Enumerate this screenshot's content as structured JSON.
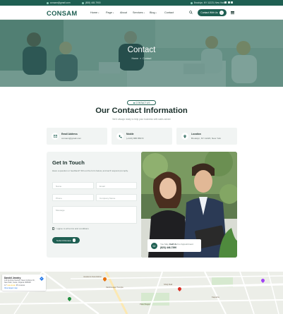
{
  "topbar": {
    "email": "consam@gmail.com",
    "phone": "(808) 445-7900",
    "address": "Brooklyn, NY 11223, New York"
  },
  "nav": {
    "logo": "CONSAM",
    "items": [
      "Home",
      "Page",
      "About",
      "Services",
      "Blog",
      "Contact"
    ],
    "cta": "Contact With Us"
  },
  "hero": {
    "title": "Contact",
    "breadcrumb_home": "Home",
    "breadcrumb_sep": "»",
    "breadcrumb_current": "Contact"
  },
  "info_section": {
    "pill": "CONTACT US",
    "title": "Our Contact Information",
    "subtitle": "We'd always ready to help your business with sales advice",
    "cards": [
      {
        "label": "Email Address",
        "value": "consam@gmail.com",
        "icon": "mail-icon"
      },
      {
        "label": "Mobile",
        "value": "(+123) 888 85672",
        "icon": "phone-icon"
      },
      {
        "label": "Location",
        "value": "Brooklyn, NY 11223, New York",
        "icon": "location-icon"
      }
    ]
  },
  "form": {
    "title": "Get In Touch",
    "description": "Have a question or feedback? Fill out the form below, and we'll respond promptly.",
    "name_placeholder": "Name",
    "email_placeholder": "Email",
    "phone_placeholder": "Phone",
    "company_placeholder": "Company Name",
    "message_placeholder": "Message",
    "agree_label": "I agree to all terms and conditions",
    "submit_label": "Submit Review"
  },
  "call_box": {
    "prefix": "You May",
    "emphasis": "Call Us",
    "suffix": "For Appointment",
    "number": "(823) 446-7390"
  },
  "map": {
    "place_name": "Darshil Jewelry",
    "address": "123 Ambica Society, Near Ambica Ch, Nav Path, Surat, Gujarat 395008",
    "rating": "4.7",
    "reviews": "35 reviews",
    "link": "View larger map",
    "labels": [
      "Jewelers Association",
      "Vaishnodevi Temple",
      "Shriji Mall",
      "Kapodra",
      "Patel Nagar"
    ]
  },
  "colors": {
    "primary": "#1f5f52",
    "panel": "#f1f4f3"
  }
}
